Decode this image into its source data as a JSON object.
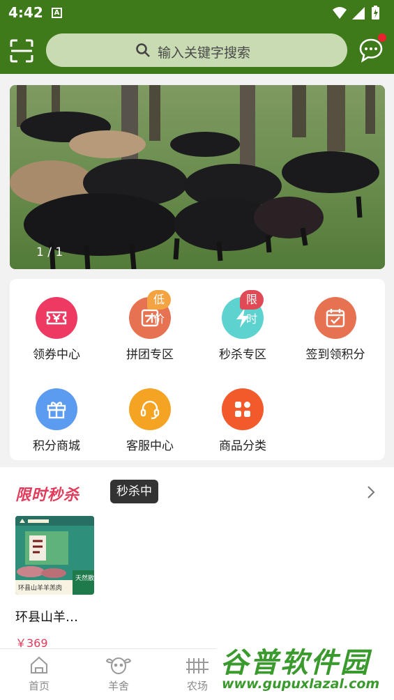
{
  "status_bar": {
    "time": "4:42",
    "notification_glyph": "A"
  },
  "header": {
    "search_placeholder": "输入关键字搜索",
    "has_message_dot": true,
    "colors": {
      "bar": "#3f7a1a",
      "search_bg": "#c8dbb3",
      "dot": "#e8232e"
    }
  },
  "banner": {
    "counter": "1 / 1"
  },
  "menu": {
    "items": [
      {
        "label": "领券中心",
        "icon": "coupon-icon",
        "color": "#ee3a62"
      },
      {
        "label": "拼团专区",
        "icon": "group-buy-icon",
        "color": "#e77252",
        "tag": "低价"
      },
      {
        "label": "秒杀专区",
        "icon": "flash-icon",
        "color": "#5cd3cf",
        "tag": "限时"
      },
      {
        "label": "签到领积分",
        "icon": "calendar-check-icon",
        "color": "#e77252"
      },
      {
        "label": "积分商城",
        "icon": "gift-icon",
        "color": "#5b9bf0"
      },
      {
        "label": "客服中心",
        "icon": "headset-icon",
        "color": "#f5a322"
      },
      {
        "label": "商品分类",
        "icon": "category-grid-icon",
        "color": "#f25a2b"
      }
    ]
  },
  "flash_sale": {
    "title": "限时秒杀",
    "status_badge": "秒杀中",
    "products": [
      {
        "name": "环县山羊…",
        "price": "￥369",
        "image_caption": "环县山羊羊羔肉",
        "image_badge": "天然散养"
      }
    ]
  },
  "tab_bar": {
    "tabs": [
      {
        "label": "首页",
        "icon": "home-icon"
      },
      {
        "label": "羊舍",
        "icon": "sheep-icon"
      },
      {
        "label": "农场",
        "icon": "fence-icon"
      }
    ]
  },
  "watermark": {
    "text": "谷普软件园",
    "url": "www.gupuxlazal.com"
  }
}
